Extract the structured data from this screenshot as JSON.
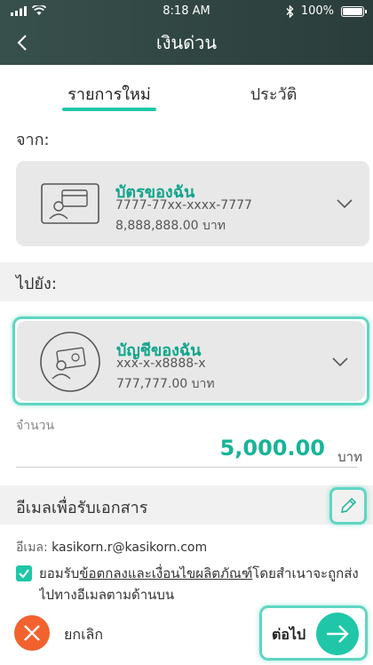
{
  "status_bar": {
    "time": "8:18 AM",
    "battery": "100%"
  },
  "header": {
    "title": "เงินด่วน"
  },
  "tabs": [
    {
      "label": "รายการใหม่"
    },
    {
      "label": "ประวัติ"
    }
  ],
  "from": {
    "section_label": "จาก:",
    "card": {
      "title": "บัตรของฉัน",
      "number": "7777-77xx-xxxx-7777",
      "amount": "8,888,888.00 บาท"
    }
  },
  "to": {
    "section_label": "ไปยัง:",
    "card": {
      "title": "บัญชีของฉัน",
      "number": "xxx-x-x8888-x",
      "amount": "777,777.00 บาท"
    }
  },
  "amount": {
    "label": "จำนวน",
    "value": "5,000.00",
    "unit": "บาท"
  },
  "email_section": {
    "title": "อีเมลเพื่อรับเอกสาร",
    "email_label": "อีเมล:",
    "email_value": "kasikorn.r@kasikorn.com",
    "terms_prefix": "ยอมรับ",
    "terms_link": "ข้อตกลงและเงื่อนไขผลิตภัณฑ์",
    "terms_suffix": "โดยสำเนาจะถูกส่งไปทางอีเมลตามด้านบน"
  },
  "footer": {
    "cancel_label": "ยกเลิก",
    "next_label": "ต่อไป"
  },
  "colors": {
    "accent": "#1fc7a8",
    "cancel": "#f2622e",
    "header": "#38504c"
  }
}
